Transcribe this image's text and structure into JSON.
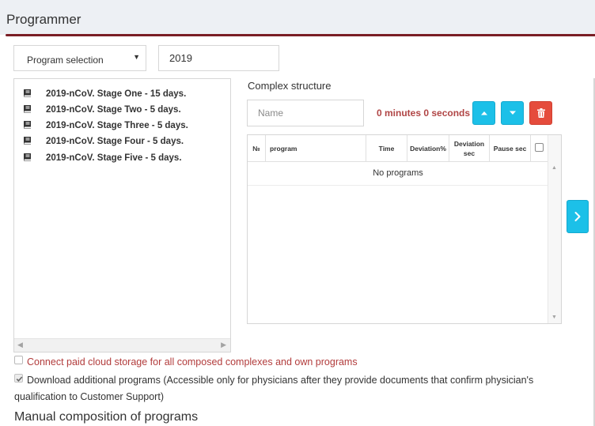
{
  "header": {
    "title": "Programmer"
  },
  "program_selection": {
    "label": "Program selection"
  },
  "year_field": {
    "value": "2019"
  },
  "program_list": {
    "items": [
      {
        "label": "2019-nCoV. Stage One - 15 days."
      },
      {
        "label": "2019-nCoV. Stage Two - 5 days."
      },
      {
        "label": "2019-nCoV. Stage Three - 5 days."
      },
      {
        "label": "2019-nCoV. Stage Four - 5 days."
      },
      {
        "label": "2019-nCoV. Stage Five - 5 days."
      }
    ],
    "icon": "book-icon"
  },
  "complex": {
    "title": "Complex structure",
    "name_placeholder": "Name",
    "duration": "0 minutes 0 seconds",
    "buttons": {
      "up": "caret-up-icon",
      "down": "caret-down-icon",
      "delete": "trash-icon"
    },
    "table": {
      "columns": [
        "№",
        "program",
        "Time",
        "Deviation%",
        "Deviation sec",
        "Pause sec"
      ],
      "empty_text": "No programs"
    },
    "next_icon": "chevron-right-icon"
  },
  "options": {
    "cloud_storage": {
      "label": "Connect paid cloud storage for all composed complexes and own programs",
      "checked": false,
      "color": "#b23c3c"
    },
    "download_additional": {
      "label": "Download additional programs (Accessible only for physicians after they provide documents that confirm physician's qualification to Customer Support)",
      "checked": true
    }
  },
  "manual_section": {
    "title": "Manual composition of programs"
  },
  "colors": {
    "accent": "#1cc0e8",
    "danger": "#e54c3c",
    "header_rule": "#7a1e25",
    "duration_text": "#b04545"
  }
}
